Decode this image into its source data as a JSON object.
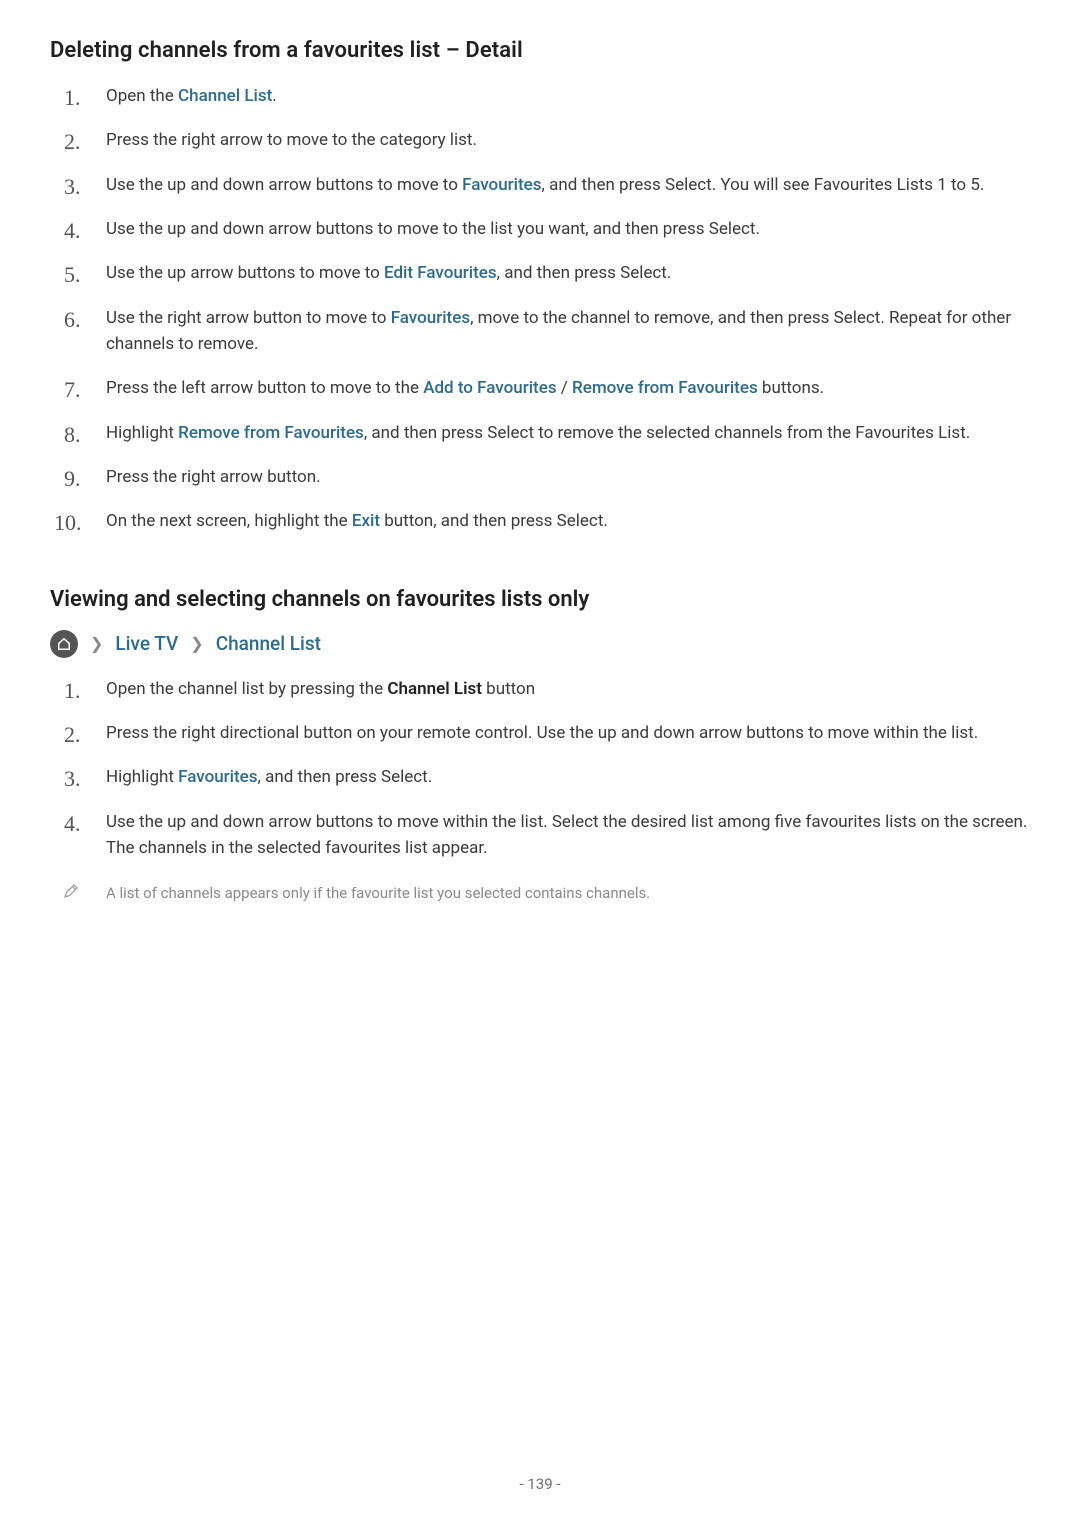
{
  "section1": {
    "heading": "Deleting channels from a favourites list – Detail",
    "steps": {
      "s1a": "Open the ",
      "s1b_link": "Channel List",
      "s1c": ".",
      "s2": "Press the right arrow to move to the category list.",
      "s3a": "Use the up and down arrow buttons to move to ",
      "s3b_link": "Favourites",
      "s3c": ", and then press Select. You will see Favourites Lists 1 to 5.",
      "s4": "Use the up and down arrow buttons to move to the list you want, and then press Select.",
      "s5a": "Use the up arrow buttons to move to ",
      "s5b_link": "Edit Favourites",
      "s5c": ", and then press Select.",
      "s6a": "Use the right arrow button to move to ",
      "s6b_link": "Favourites",
      "s6c": ", move to the channel to remove, and then press Select. Repeat for other channels to remove.",
      "s7a": "Press the left arrow button to move to the ",
      "s7b_link": "Add to Favourites",
      "s7c": " / ",
      "s7d_link": "Remove from Favourites",
      "s7e": " buttons.",
      "s8a": "Highlight ",
      "s8b_link": "Remove from Favourites",
      "s8c": ", and then press Select to remove the selected channels from the Favourites List.",
      "s9": "Press the right arrow button.",
      "s10a": "On the next screen, highlight the ",
      "s10b_link": "Exit",
      "s10c": " button, and then press Select."
    }
  },
  "section2": {
    "heading": "Viewing and selecting channels on favourites lists only",
    "nav": {
      "item1": "Live TV",
      "item2": "Channel List"
    },
    "steps": {
      "s1a": "Open the channel list by pressing the ",
      "s1b_bold": "Channel List",
      "s1c": " button",
      "s2": "Press the right directional button on your remote control. Use the up and down arrow buttons to move within the list.",
      "s3a": "Highlight ",
      "s3b_link": "Favourites",
      "s3c": ", and then press Select.",
      "s4": "Use the up and down arrow buttons to move within the list. Select the desired list among five favourites lists on the screen. The channels in the selected favourites list appear."
    },
    "note": "A list of channels appears only if the favourite list you selected contains channels."
  },
  "footer": "- 139 -"
}
